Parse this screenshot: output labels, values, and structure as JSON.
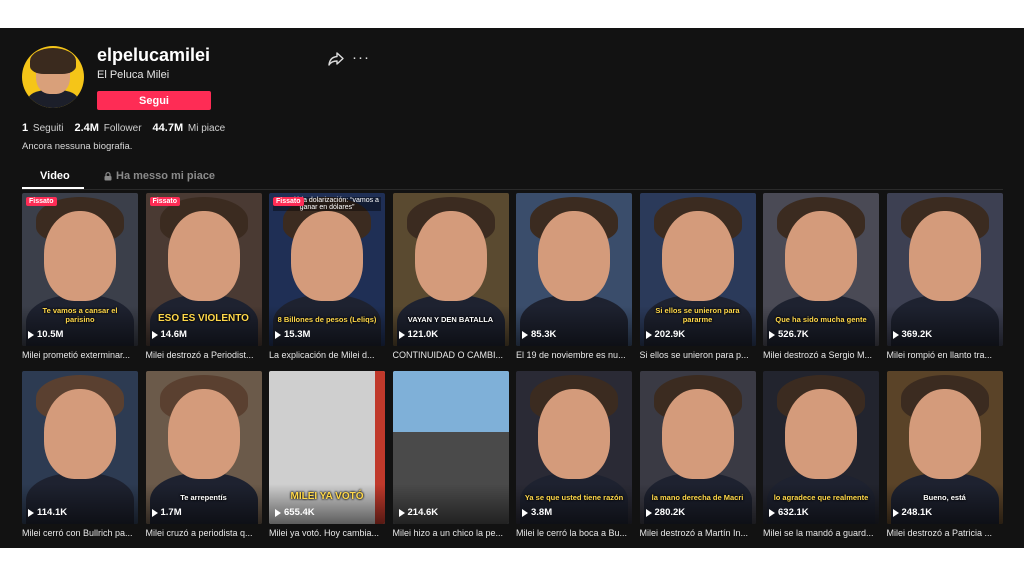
{
  "profile": {
    "username": "elpelucamilei",
    "nickname": "El Peluca Milei",
    "follow_label": "Segui",
    "bio": "Ancora nessuna biografia.",
    "stats": [
      {
        "value": "1",
        "label": "Seguiti"
      },
      {
        "value": "2.4M",
        "label": "Follower"
      },
      {
        "value": "44.7M",
        "label": "Mi piace"
      }
    ]
  },
  "icons": {
    "share": "share-icon",
    "more": "more-icon",
    "lock": "lock-icon",
    "play": "play-icon"
  },
  "tabs": [
    {
      "label": "Video",
      "active": true
    },
    {
      "label": "Ha messo mi piace",
      "locked": true
    }
  ],
  "more_glyph": "···",
  "videos": [
    {
      "views": "10.5M",
      "title": "Milei prometió exterminar...",
      "pinned": "Fissato",
      "caption": "Te vamos a cansar el parisino",
      "bg": "#3b3f4a"
    },
    {
      "views": "14.6M",
      "title": "Milei destrozó a Periodist...",
      "pinned": "Fissato",
      "caption": "ESO ES VIOLENTO",
      "bg": "#4a3a33"
    },
    {
      "views": "15.3M",
      "title": "La explicación de Milei d...",
      "pinned": "Fissato",
      "caption": "8 Billones de pesos (Leliqs)",
      "top_text": "anunció la dolarización: “vamos a ganar en dólares”",
      "bg": "#1f2f55"
    },
    {
      "views": "121.0K",
      "title": "CONTINUIDAD O CAMBI...",
      "caption": "VAYAN Y DEN BATALLA",
      "bg": "#5a4a30"
    },
    {
      "views": "85.3K",
      "title": "El 19 de noviembre es nu...",
      "bg": "#3a4d6b"
    },
    {
      "views": "202.9K",
      "title": "Si ellos se unieron para p...",
      "caption": "Si ellos se unieron para pararme",
      "bg": "#2b3a5a"
    },
    {
      "views": "526.7K",
      "title": "Milei destrozó a Sergio M...",
      "caption": "Que ha sido mucha gente",
      "bg": "#4a4a55"
    },
    {
      "views": "369.2K",
      "title": "Milei rompió en llanto tra...",
      "bg": "#3d4052"
    },
    {
      "views": "114.1K",
      "title": "Milei cerró con Bullrich pa...",
      "bg": "#2d3b52"
    },
    {
      "views": "1.7M",
      "title": "Milei cruzó a periodista q...",
      "caption": "Te arrepentís",
      "bg": "#6b5a4a"
    },
    {
      "views": "655.4K",
      "title": "Milei ya votó. Hoy cambia...",
      "caption": "MILEI YA VOTÓ",
      "bg": "#cfcfcf"
    },
    {
      "views": "214.6K",
      "title": "Milei hizo a un chico la pe...",
      "bg": "#6a7a8a"
    },
    {
      "views": "3.8M",
      "title": "Milei le cerró la boca a Bu...",
      "caption": "Ya se que usted tiene razón",
      "bg": "#2a2a35"
    },
    {
      "views": "280.2K",
      "title": "Milei destrozó a Martín In...",
      "caption": "la mano derecha de Macri",
      "bg": "#3a3a44"
    },
    {
      "views": "632.1K",
      "title": "Milei se la mandó a guard...",
      "caption": "lo agradece que realmente",
      "bg": "#22242e"
    },
    {
      "views": "248.1K",
      "title": "Milei destrozó a Patricia ...",
      "caption": "Bueno, está",
      "bg": "#5a4328"
    }
  ]
}
